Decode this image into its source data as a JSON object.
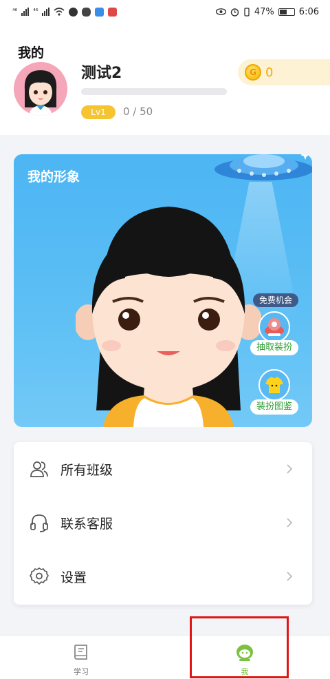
{
  "status_bar": {
    "left_signal_labels": [
      "⁴⁶",
      "⁴⁶"
    ],
    "battery_percent": "47%",
    "time": "6:06"
  },
  "header": {
    "page_title": "我的",
    "username": "测试2",
    "level_badge": "Lv1",
    "xp_progress": "0 / 50",
    "coins": "0",
    "coin_glyph": "G"
  },
  "avatar_card": {
    "title": "我的形象",
    "free_chance_label": "免费机会",
    "draw_outfit_label": "抽取装扮",
    "outfit_gallery_label": "装扮图鉴"
  },
  "menu": {
    "items": [
      {
        "label": "所有班级",
        "icon": "users-icon"
      },
      {
        "label": "联系客服",
        "icon": "headset-icon"
      },
      {
        "label": "设置",
        "icon": "gear-icon"
      }
    ]
  },
  "tabbar": {
    "tabs": [
      {
        "label": "学习",
        "icon": "book-icon",
        "active": false
      },
      {
        "label": "我",
        "icon": "profile-face-icon",
        "active": true
      }
    ]
  },
  "colors": {
    "accent_green": "#7cc142",
    "brand_blue": "#4cb5f3",
    "coin_gold": "#f3a900",
    "highlight_red": "#e01414"
  }
}
